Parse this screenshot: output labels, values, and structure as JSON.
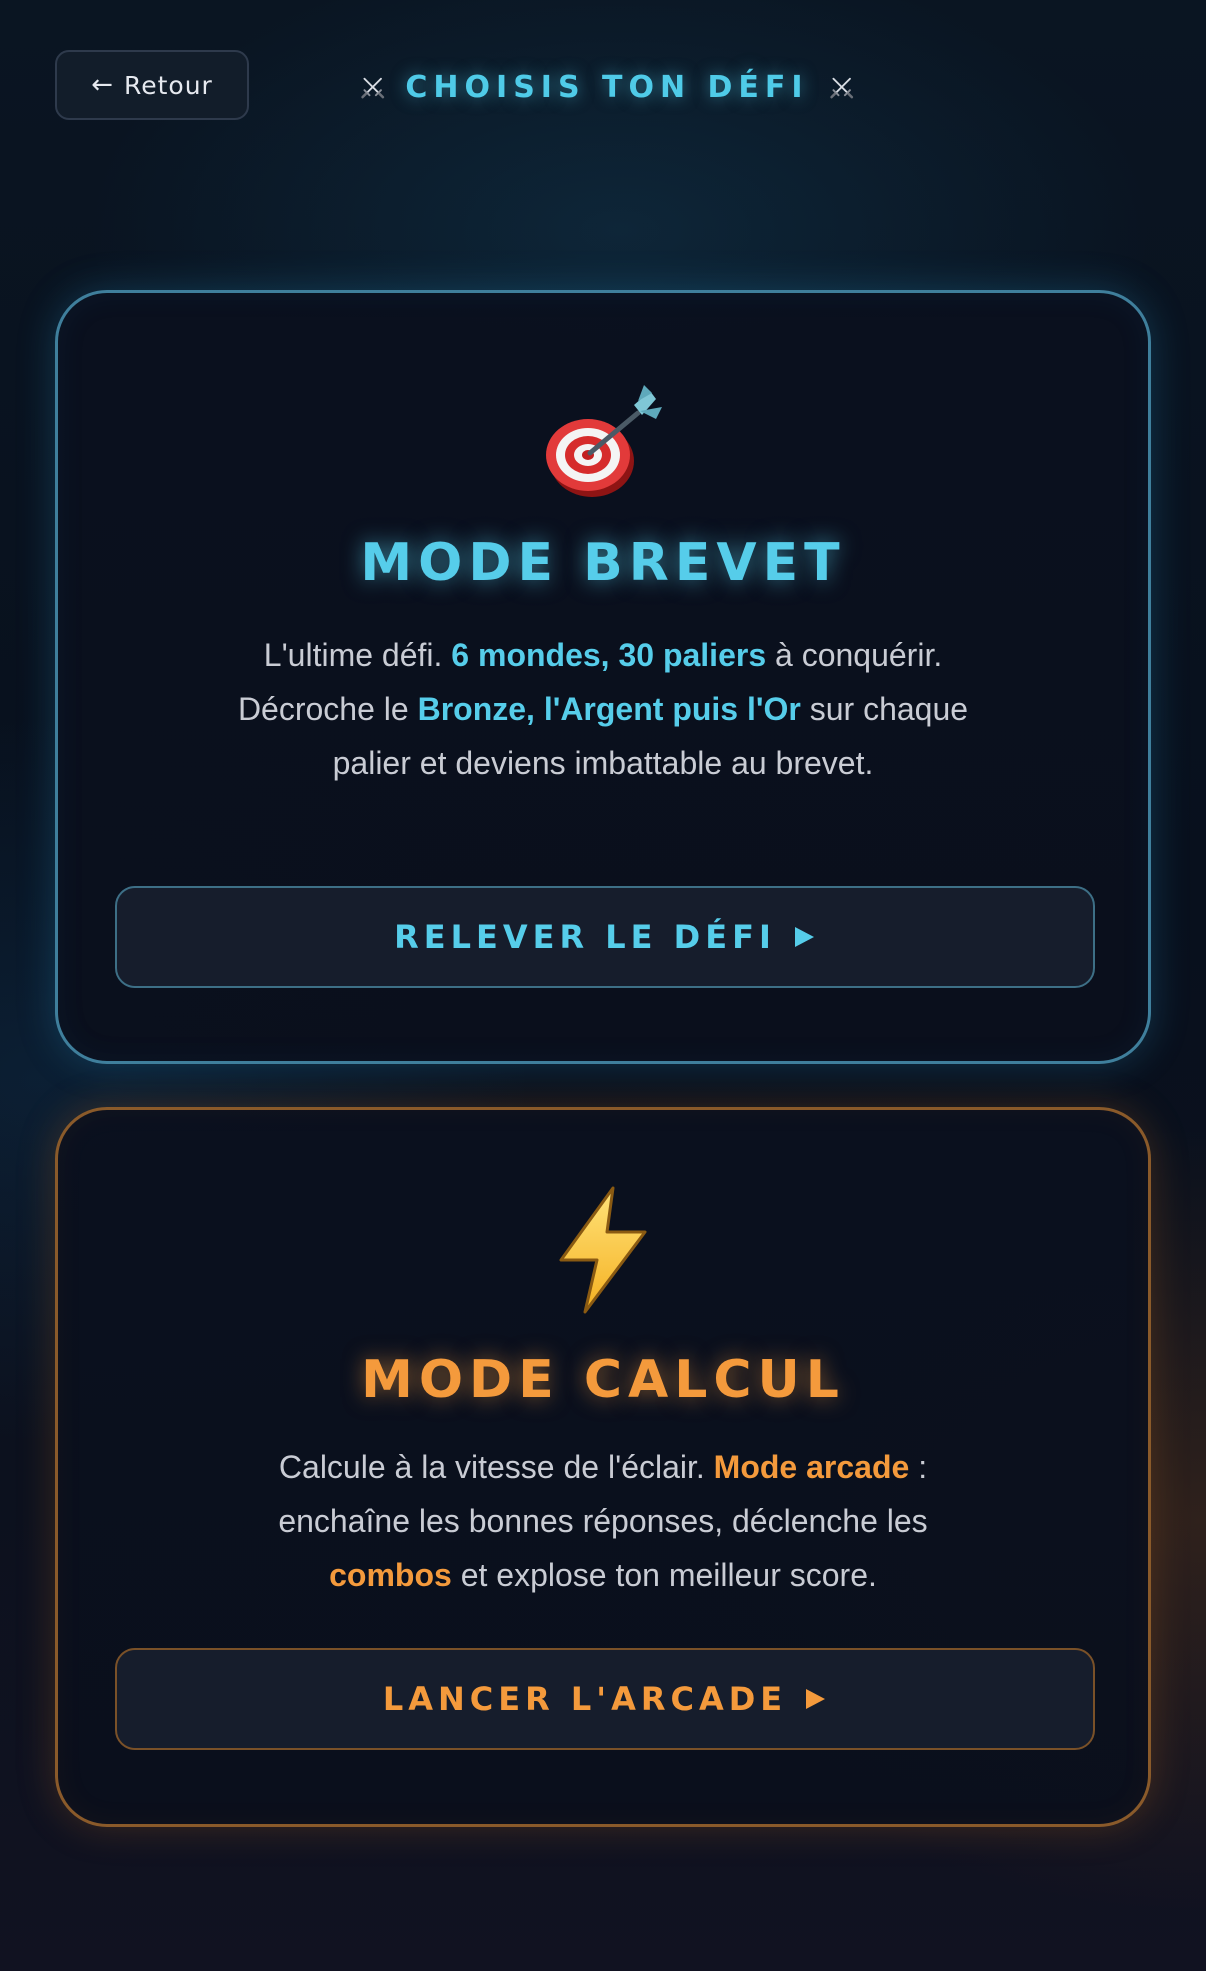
{
  "header": {
    "back_label": "Retour",
    "back_icon": "arrow-left-icon",
    "title": "CHOISIS TON DÉFI",
    "title_icon": "crossed-swords-icon"
  },
  "modes": {
    "brevet": {
      "icon": "direct-hit-target-icon",
      "title": "MODE BREVET",
      "desc": {
        "p1": "L'ultime défi. ",
        "h1": "6 mondes, 30 paliers",
        "p2": " à conquérir. Décroche le ",
        "h2": "Bronze, l'Argent puis l'Or",
        "p3": " sur chaque palier et deviens imbattable au brevet."
      },
      "button_label": "RELEVER LE DÉFI",
      "button_icon": "play-triangle-icon",
      "accent_color": "#56cdea"
    },
    "calcul": {
      "icon": "lightning-bolt-icon",
      "title": "MODE CALCUL",
      "desc": {
        "p1": "Calcule à la vitesse de l'éclair. ",
        "h1": "Mode arcade",
        "p2": " : enchaîne les bonnes réponses, déclenche les ",
        "h2": "combos",
        "p3": " et explose ton meilleur score."
      },
      "button_label": "LANCER L'ARCADE",
      "button_icon": "play-triangle-icon",
      "accent_color": "#f49a3c"
    }
  }
}
